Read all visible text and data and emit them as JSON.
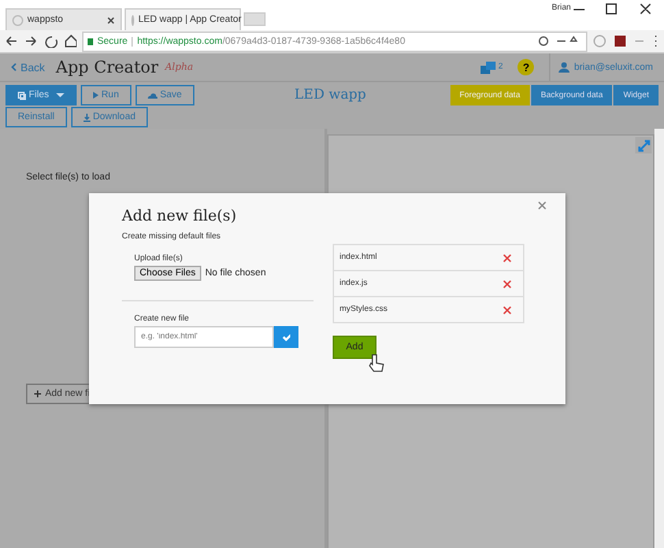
{
  "browser": {
    "profile": "Brian",
    "tabs": [
      {
        "title": "wappsto",
        "selected": false
      },
      {
        "title": "LED wapp | App Creator",
        "selected": true
      }
    ],
    "secure_label": "Secure",
    "url_host": "https://wappsto.com",
    "url_path": "/0679a4d3-0187-4739-9368-1a5b6c4f4e80"
  },
  "header": {
    "back": "Back",
    "title": "App Creator",
    "badge": "Alpha",
    "notifications": "2",
    "help": "?",
    "user": "brian@seluxit.com"
  },
  "toolbar": {
    "buttons": [
      {
        "label": "Files",
        "kind": "dropdown"
      },
      {
        "label": "Run",
        "kind": "run"
      },
      {
        "label": "Save",
        "kind": "save"
      },
      {
        "label": "Reinstall",
        "kind": "plain"
      },
      {
        "label": "Download",
        "kind": "download"
      }
    ],
    "app_name": "LED wapp",
    "data_tabs": [
      {
        "label": "Foreground data",
        "selected": true
      },
      {
        "label": "Background data",
        "selected": false
      },
      {
        "label": "Widget",
        "selected": false
      }
    ]
  },
  "left_panel": {
    "hint": "Select file(s) to load",
    "add_button": "Add new fi"
  },
  "modal": {
    "title": "Add new file(s)",
    "subtitle": "Create missing default files",
    "upload_label": "Upload file(s)",
    "choose_button": "Choose Files",
    "no_file": "No file chosen",
    "create_label": "Create new file",
    "create_placeholder": "e.g. 'index.html'",
    "files": [
      {
        "name": "index.html"
      },
      {
        "name": "index.js"
      },
      {
        "name": "myStyles.css"
      }
    ],
    "add_button": "Add"
  }
}
